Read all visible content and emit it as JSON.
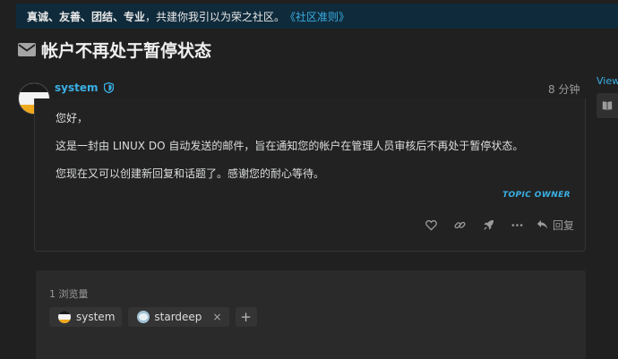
{
  "banner": {
    "bold_text": "真诚、友善、团结、专业",
    "text": "，共建你我引以为荣之社区。",
    "link": "《社区准则》"
  },
  "topic": {
    "title": "帐户不再处于暂停状态",
    "title_icon": "envelope-icon"
  },
  "post": {
    "username": "system",
    "user_badge_icon": "shield-icon",
    "time": "8 分钟",
    "paragraphs": [
      "您好，",
      "这是一封由 LINUX DO 自动发送的邮件，旨在通知您的帐户在管理人员审核后不再处于暂停状态。",
      "您现在又可以创建新回复和话题了。感谢您的耐心等待。"
    ],
    "owner_label": "TOPIC OWNER",
    "actions": [
      "like-icon",
      "link-icon",
      "rocket-icon",
      "more-icon"
    ],
    "reply_label": "回复"
  },
  "sidebar": {
    "view_label": "View"
  },
  "info": {
    "views": "1 浏览量",
    "participants": [
      {
        "name": "system",
        "removable": false
      },
      {
        "name": "stardeep",
        "removable": true,
        "remove_label": "×"
      }
    ],
    "add_label": "+"
  },
  "colors": {
    "accent": "#3ab0e6",
    "background": "#202020",
    "banner": "#0f2a3a",
    "avatar_yellow": "#f0a81c"
  }
}
